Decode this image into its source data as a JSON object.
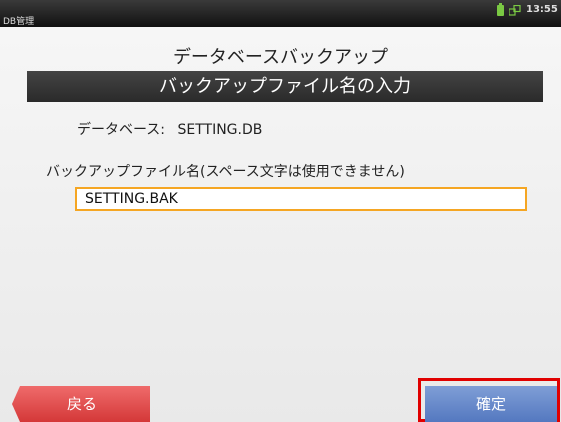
{
  "statusbar": {
    "app_title": "DB管理",
    "time": "13:55",
    "battery_color": "#7ac943"
  },
  "page": {
    "title": "データベースバックアップ"
  },
  "section": {
    "header": "バックアップファイル名の入力"
  },
  "database": {
    "label": "データベース:",
    "value": "SETTING.DB"
  },
  "backup": {
    "field_label": "バックアップファイル名(スペース文字は使用できません)",
    "filename_value": "SETTING.BAK"
  },
  "buttons": {
    "back": "戻る",
    "confirm": "確定"
  },
  "icons": {
    "battery": "battery-icon",
    "network": "network-icon"
  },
  "colors": {
    "highlight": "#e00000",
    "input_border": "#f5a623"
  }
}
